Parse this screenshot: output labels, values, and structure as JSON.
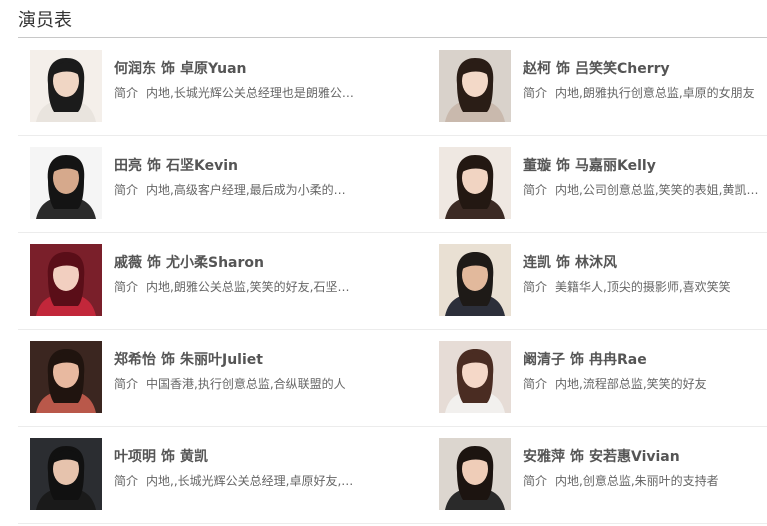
{
  "section_title": "演员表",
  "separator_word": "饰",
  "intro_label": "简介",
  "cast": [
    {
      "actor": "何润东",
      "role": "卓原Yuan",
      "intro": "内地,长城光辉公关总经理也是朗雅公关青洁工",
      "photo": {
        "bg": "#f4efea",
        "hair": "#1b1b1b",
        "skin": "#f0d6c4",
        "cloth": "#e9e4de"
      }
    },
    {
      "actor": "赵柯",
      "role": "吕笑笑Cherry",
      "intro": "内地,朗雅执行创意总监,卓原的女朋友",
      "photo": {
        "bg": "#d9d2cb",
        "hair": "#2a1d16",
        "skin": "#f3d9c8",
        "cloth": "#c9b9ad"
      }
    },
    {
      "actor": "田亮",
      "role": "石坚Kevin",
      "intro": "内地,高级客户经理,最后成为小柔的男朋友",
      "photo": {
        "bg": "#f5f5f5",
        "hair": "#141414",
        "skin": "#d6a98c",
        "cloth": "#2b2b2b"
      }
    },
    {
      "actor": "董璇",
      "role": "马嘉丽Kelly",
      "intro": "内地,公司创意总监,笑笑的表姐,黄凯的女朋友",
      "photo": {
        "bg": "#efe8e2",
        "hair": "#231812",
        "skin": "#f1d4c2",
        "cloth": "#3b2a24"
      }
    },
    {
      "actor": "戚薇",
      "role": "尤小柔Sharon",
      "intro": "内地,朗雅公关总监,笑笑的好友,石坚的女朋友",
      "photo": {
        "bg": "#7a1f2a",
        "hair": "#5a0e18",
        "skin": "#f2cfc0",
        "cloth": "#c2273a"
      }
    },
    {
      "actor": "连凯",
      "role": "林沐风",
      "intro": "美籍华人,顶尖的摄影师,喜欢笑笑",
      "photo": {
        "bg": "#e9e0d3",
        "hair": "#1e1a17",
        "skin": "#e2b99c",
        "cloth": "#2c2f3a"
      }
    },
    {
      "actor": "郑希怡",
      "role": "朱丽叶Juliet",
      "intro": "中国香港,执行创意总监,合纵联盟的人",
      "photo": {
        "bg": "#3b2620",
        "hair": "#20140f",
        "skin": "#e8b9a0",
        "cloth": "#b9584a"
      }
    },
    {
      "actor": "阚清子",
      "role": "冉冉Rae",
      "intro": "内地,流程部总监,笑笑的好友",
      "photo": {
        "bg": "#e6dcd6",
        "hair": "#4a2c22",
        "skin": "#f5d8c8",
        "cloth": "#f2f0ee"
      }
    },
    {
      "actor": "叶项明",
      "role": "黄凯",
      "intro": "内地,,长城光辉公关总经理,卓原好友,马佳丽男朋友",
      "photo": {
        "bg": "#2b2d31",
        "hair": "#111111",
        "skin": "#e6c3ad",
        "cloth": "#1a1a1a"
      }
    },
    {
      "actor": "安雅萍",
      "role": "安若惠Vivian",
      "intro": "内地,创意总监,朱丽叶的支持者",
      "photo": {
        "bg": "#dcd6cf",
        "hair": "#1c1410",
        "skin": "#efcdb8",
        "cloth": "#2a2a2a"
      }
    }
  ]
}
